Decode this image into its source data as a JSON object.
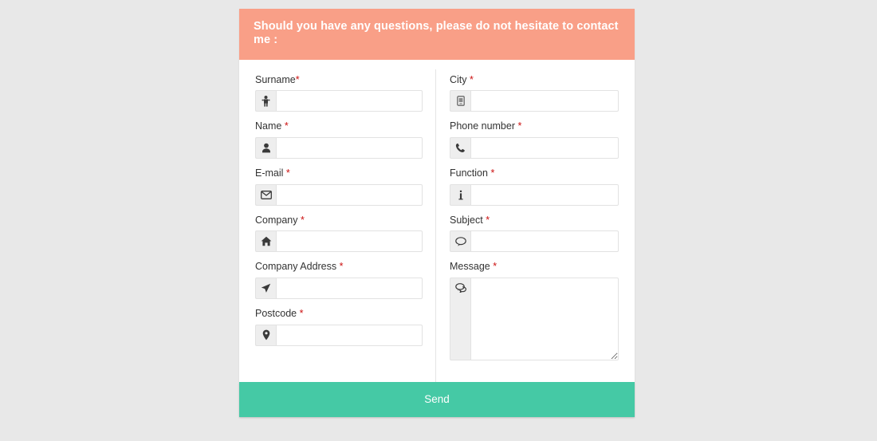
{
  "card": {
    "header": {
      "title": "Should you have any questions, please do not hesitate to contact me :",
      "background_color": "#f99f87",
      "text_color": "#ffffff"
    },
    "submit": {
      "label": "Send",
      "background_color": "#45c9a5",
      "text_color": "#ffffff"
    },
    "required_marker": "*",
    "left_column": [
      {
        "label": "Surname",
        "required_marker": "*",
        "label_space_before_marker": false,
        "icon": "male-person-icon",
        "value": "",
        "placeholder": "",
        "type": "text"
      },
      {
        "label": "Name",
        "required_marker": "*",
        "label_space_before_marker": true,
        "icon": "user-icon",
        "value": "",
        "placeholder": "",
        "type": "text"
      },
      {
        "label": "E-mail",
        "required_marker": "*",
        "label_space_before_marker": true,
        "icon": "envelope-icon",
        "value": "",
        "placeholder": "",
        "type": "text"
      },
      {
        "label": "Company",
        "required_marker": "*",
        "label_space_before_marker": true,
        "icon": "home-icon",
        "value": "",
        "placeholder": "",
        "type": "text"
      },
      {
        "label": "Company Address",
        "required_marker": "*",
        "label_space_before_marker": true,
        "icon": "location-arrow-icon",
        "value": "",
        "placeholder": "",
        "type": "text"
      },
      {
        "label": "Postcode",
        "required_marker": "*",
        "label_space_before_marker": true,
        "icon": "map-marker-icon",
        "value": "",
        "placeholder": "",
        "type": "text"
      }
    ],
    "right_column": [
      {
        "label": "City",
        "required_marker": "*",
        "label_space_before_marker": true,
        "icon": "building-icon",
        "value": "",
        "placeholder": "",
        "type": "text"
      },
      {
        "label": "Phone number",
        "required_marker": "*",
        "label_space_before_marker": true,
        "icon": "phone-icon",
        "value": "",
        "placeholder": "",
        "type": "text"
      },
      {
        "label": "Function",
        "required_marker": "*",
        "label_space_before_marker": true,
        "icon": "info-icon",
        "value": "",
        "placeholder": "",
        "type": "text"
      },
      {
        "label": "Subject",
        "required_marker": "*",
        "label_space_before_marker": true,
        "icon": "comment-icon",
        "value": "",
        "placeholder": "",
        "type": "text"
      },
      {
        "label": "Message",
        "required_marker": "*",
        "label_space_before_marker": true,
        "icon": "comments-icon",
        "value": "",
        "placeholder": "",
        "type": "textarea"
      }
    ]
  },
  "page": {
    "background_color": "#e8e8e8"
  }
}
